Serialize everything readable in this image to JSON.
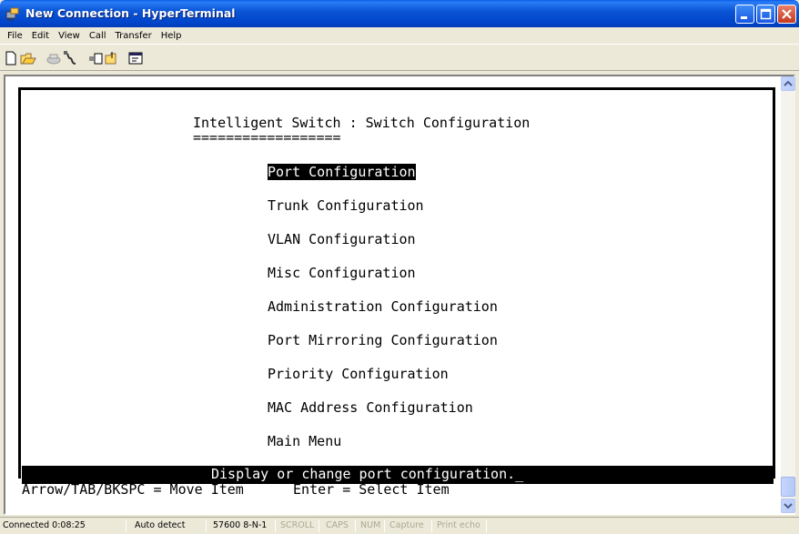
{
  "window": {
    "title": "New Connection - HyperTerminal"
  },
  "menu": [
    "File",
    "Edit",
    "View",
    "Call",
    "Transfer",
    "Help"
  ],
  "toolbar": {
    "icons": [
      "new-icon",
      "open-icon",
      "call-icon",
      "disconnect-icon",
      "send-icon",
      "receive-icon",
      "properties-icon"
    ]
  },
  "terminal": {
    "header": "Intelligent Switch : Switch Configuration",
    "underline": "==================",
    "menu_items": [
      "Port Configuration",
      "Trunk Configuration",
      "VLAN Configuration",
      "Misc Configuration",
      "Administration Configuration",
      "Port Mirroring Configuration",
      "Priority Configuration",
      "MAC Address Configuration",
      "Main Menu"
    ],
    "selected_index": 0,
    "help_text": "Display or change port configuration._",
    "key_hints": "Arrow/TAB/BKSPC = Move Item      Enter = Select Item"
  },
  "statusbar": {
    "connected": "Connected 0:08:25",
    "detect": "Auto detect",
    "settings": "57600 8-N-1",
    "scroll": "SCROLL",
    "caps": "CAPS",
    "num": "NUM",
    "capture": "Capture",
    "print_echo": "Print echo"
  },
  "colors": {
    "titlebar": "#0b56d6",
    "terminal_bg": "#ffffff",
    "terminal_fg": "#000000"
  }
}
